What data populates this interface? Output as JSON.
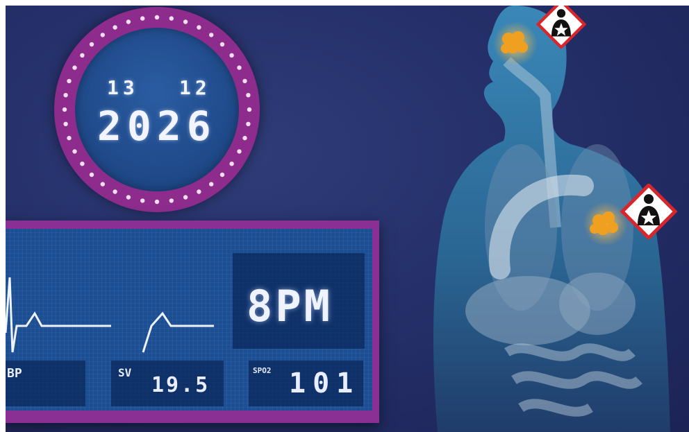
{
  "date": {
    "day": "13",
    "month": "12",
    "year": "2026"
  },
  "monitor": {
    "bpm_label": "8PM",
    "bp_label": "BP",
    "sv_label": "SV",
    "sv_value": "19.5",
    "spo2_label": "SPO2",
    "spo2_value": "101"
  },
  "hazards": [
    {
      "icon": "health-hazard-icon",
      "location": "mouth"
    },
    {
      "icon": "health-hazard-icon",
      "location": "lung"
    }
  ],
  "particles": [
    "particle-cluster-mouth",
    "particle-cluster-lung"
  ],
  "colors": {
    "background": "#25306a",
    "dial_ring": "#8d2c8c",
    "screen": "#1b4e93",
    "monitor_frame": "#8a2f94",
    "body": "#2a6e9c",
    "hazard_red": "#d9262c",
    "particle": "#f0a020"
  }
}
